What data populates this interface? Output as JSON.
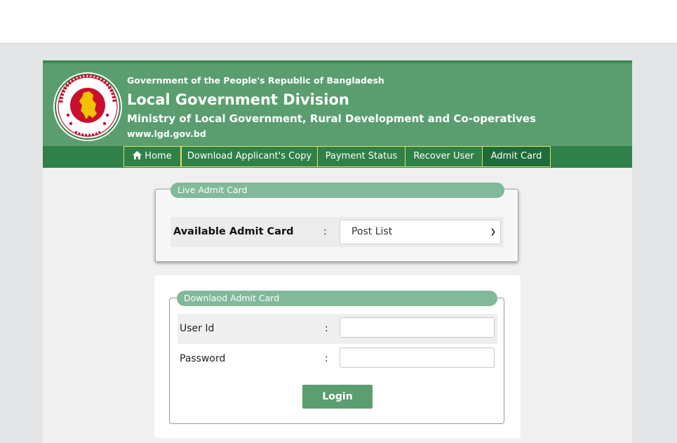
{
  "header": {
    "gov_line": "Government of the People's Republic of Bangladesh",
    "title": "Local Government Division",
    "ministry": "Ministry of Local Government, Rural Development and Co-operatives",
    "url": "www.lgd.gov.bd",
    "logo_text": "গণপ্রজাতন্ত্রী বাংলাদেশ সরকার"
  },
  "nav": {
    "items": [
      {
        "label": "Home",
        "icon": "home-icon"
      },
      {
        "label": "Download Applicant's Copy"
      },
      {
        "label": "Payment Status"
      },
      {
        "label": "Recover User"
      },
      {
        "label": "Admit Card",
        "active": true
      }
    ]
  },
  "live_card": {
    "legend": "Live Admit Card",
    "label": "Available Admit Card",
    "colon": ":",
    "select_value": "Post List"
  },
  "download_card": {
    "legend": "Downlaod Admit Card",
    "user_label": "User Id",
    "password_label": "Password",
    "colon": ":",
    "login_label": "Login"
  },
  "colors": {
    "header_green": "#5a9e6f",
    "nav_green": "#2f8049",
    "nav_border": "#e4e061",
    "pill_green": "#81b99a",
    "button_green": "#5b9e72"
  }
}
